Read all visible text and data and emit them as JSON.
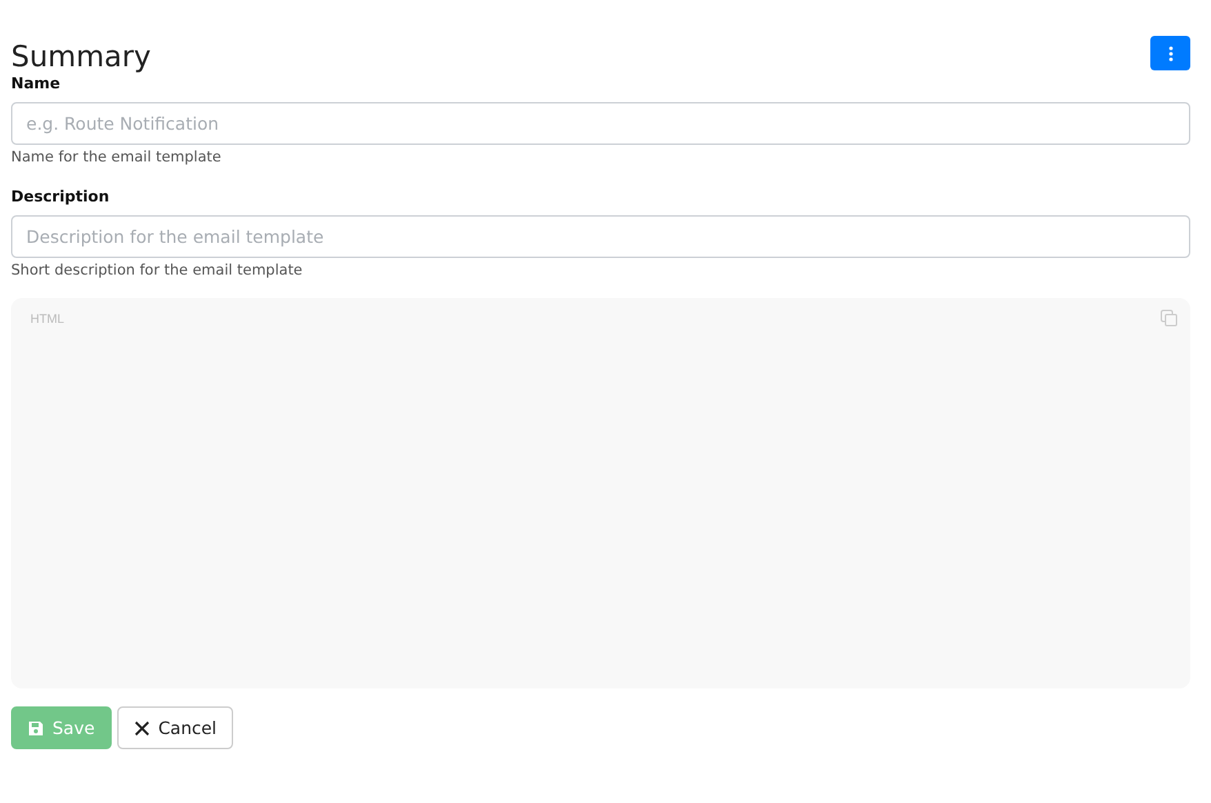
{
  "title": "Summary",
  "fields": [
    {
      "label": "Name",
      "placeholder": "e.g. Route Notification",
      "help": "Name for the email template"
    },
    {
      "label": "Description",
      "placeholder": "Description for the email template",
      "help": "Short description for the email template"
    }
  ],
  "editor": {
    "mode": "HTML"
  },
  "buttons": [
    {
      "label": "Save",
      "kind": "save",
      "disabled": true
    },
    {
      "label": "Cancel",
      "kind": "cancel",
      "disabled": false
    }
  ]
}
